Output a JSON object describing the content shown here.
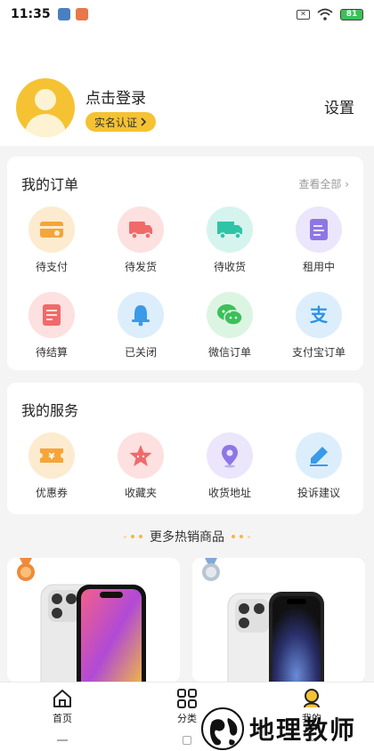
{
  "status_bar": {
    "time": "11:35",
    "battery": "81"
  },
  "header": {
    "login_text": "点击登录",
    "verify_label": "实名认证",
    "settings_label": "设置"
  },
  "orders": {
    "title": "我的订单",
    "see_all": "查看全部",
    "row1": [
      {
        "label": "待支付",
        "icon": "wallet-icon",
        "bg": "#fdebd0",
        "fg": "#f5a53a"
      },
      {
        "label": "待发货",
        "icon": "delivery-truck-icon",
        "bg": "#fde0e0",
        "fg": "#f06a6a"
      },
      {
        "label": "待收货",
        "icon": "truck-icon",
        "bg": "#d6f4ee",
        "fg": "#2fc4a5"
      },
      {
        "label": "租用中",
        "icon": "document-icon",
        "bg": "#ebe6fb",
        "fg": "#8e76e6"
      }
    ],
    "row2": [
      {
        "label": "待结算",
        "icon": "bill-icon",
        "bg": "#fde0e0",
        "fg": "#f06a6a"
      },
      {
        "label": "已关闭",
        "icon": "bell-icon",
        "bg": "#dceefb",
        "fg": "#3a9ae8"
      },
      {
        "label": "微信订单",
        "icon": "wechat-icon",
        "bg": "#dcf5e2",
        "fg": "#3cc05a"
      },
      {
        "label": "支付宝订单",
        "icon": "alipay-icon",
        "bg": "#dceefb",
        "fg": "#2b93e6"
      }
    ]
  },
  "services": {
    "title": "我的服务",
    "items": [
      {
        "label": "优惠券",
        "icon": "coupon-icon",
        "bg": "#fdebd0",
        "fg": "#f5a53a"
      },
      {
        "label": "收藏夹",
        "icon": "star-icon",
        "bg": "#fde0e0",
        "fg": "#f06a6a"
      },
      {
        "label": "收货地址",
        "icon": "location-pin-icon",
        "bg": "#ebe6fb",
        "fg": "#8e76e6"
      },
      {
        "label": "投诉建议",
        "icon": "edit-icon",
        "bg": "#dceefb",
        "fg": "#3a9ae8"
      }
    ]
  },
  "hot": {
    "title": "更多热销商品"
  },
  "tabs": [
    {
      "label": "首页",
      "icon": "home-icon"
    },
    {
      "label": "分类",
      "icon": "category-grid-icon"
    },
    {
      "label": "我的",
      "icon": "profile-icon"
    }
  ],
  "watermark": {
    "text": "地理教师"
  }
}
